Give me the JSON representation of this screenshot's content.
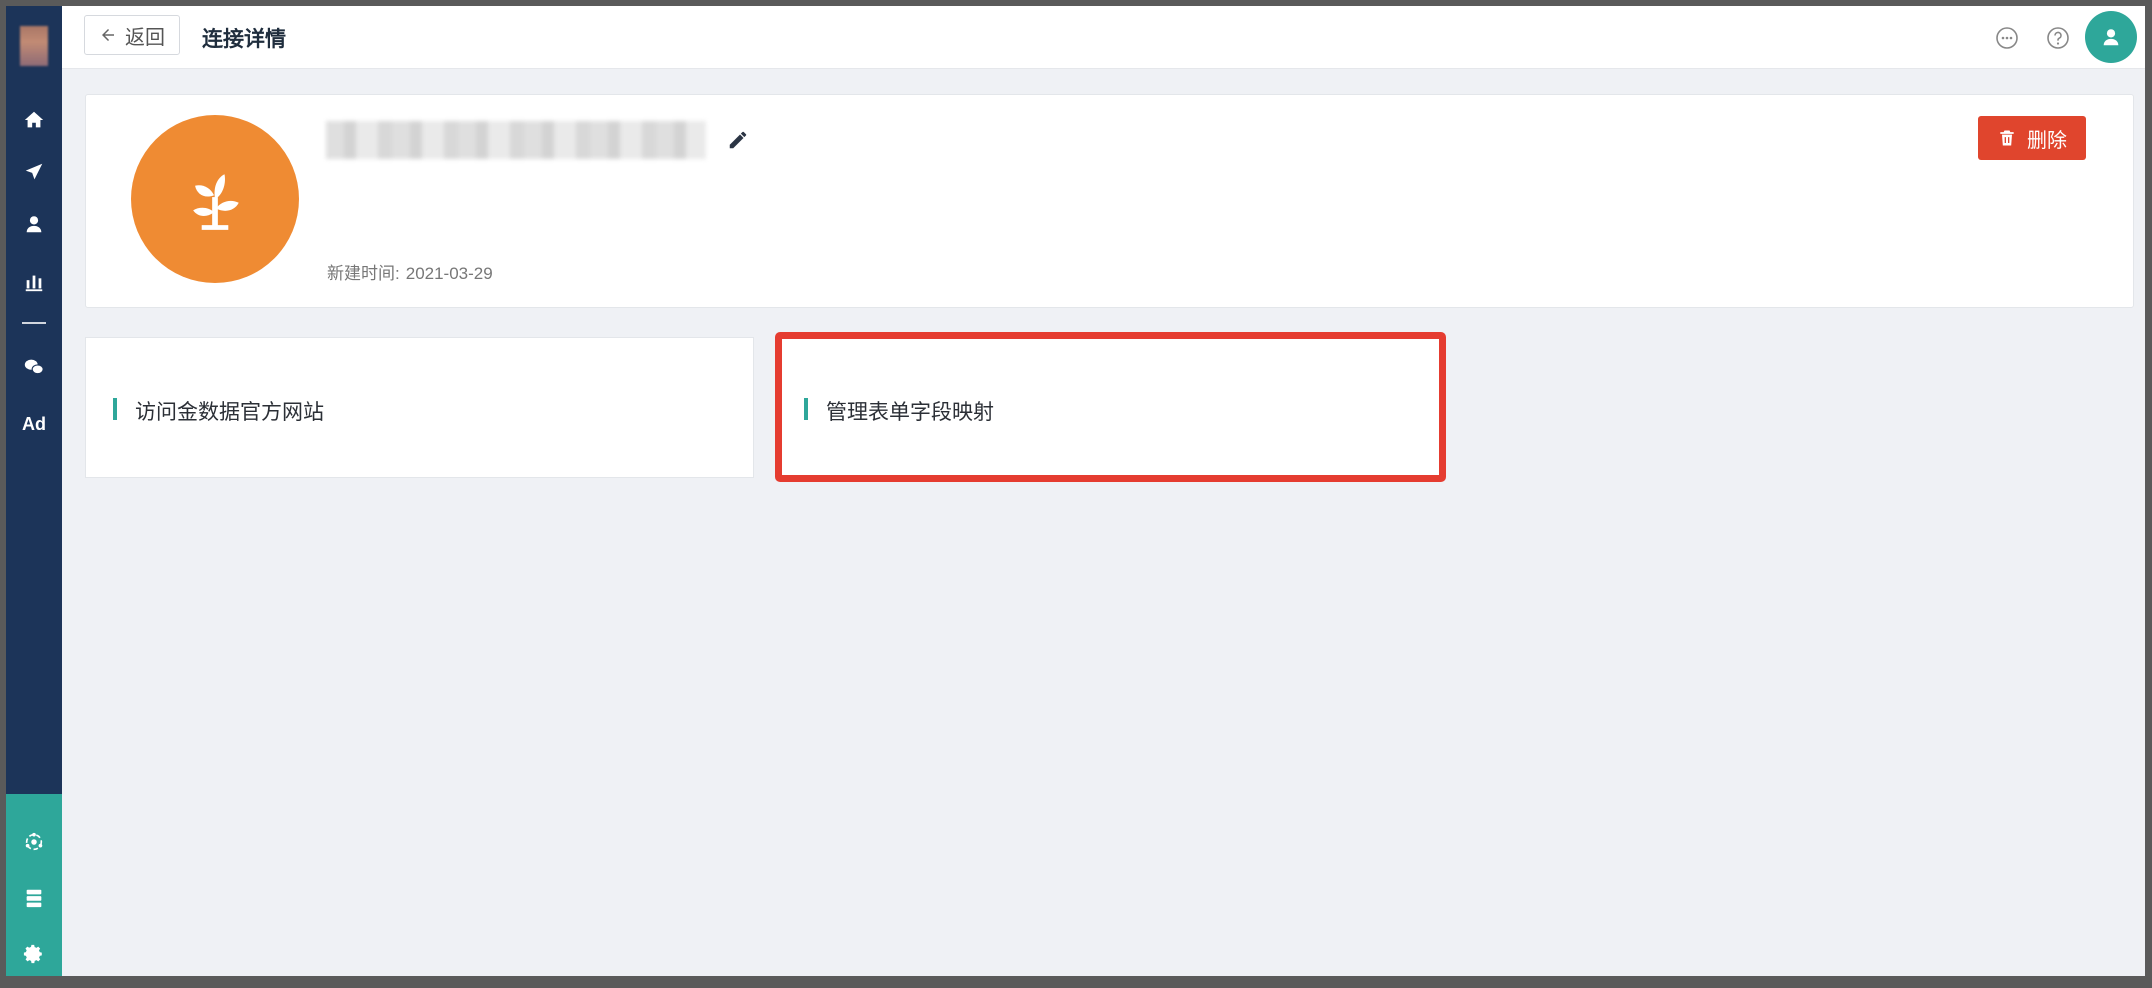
{
  "header": {
    "back_label": "返回",
    "title": "连接详情"
  },
  "sidebar": {
    "items": [
      {
        "icon": "home-icon"
      },
      {
        "icon": "send-icon"
      },
      {
        "icon": "user-icon"
      },
      {
        "icon": "bar-chart-icon"
      },
      {
        "icon": "wechat-icon"
      },
      {
        "icon": "ad-icon",
        "label": "Ad"
      }
    ],
    "bottom_items": [
      {
        "icon": "connection-hub-icon"
      },
      {
        "icon": "server-icon"
      },
      {
        "icon": "gear-icon"
      }
    ]
  },
  "connection": {
    "created_label": "新建时间:",
    "created_date": "2021-03-29",
    "delete_label": "删除"
  },
  "actions": [
    {
      "label": "访问金数据官方网站"
    },
    {
      "label": "管理表单字段映射",
      "highlighted": true
    }
  ],
  "colors": {
    "sidebar": "#1c3459",
    "accent": "#2ea79a",
    "logo": "#ef8b33",
    "danger": "#e0452d",
    "highlight": "#e53c30"
  }
}
